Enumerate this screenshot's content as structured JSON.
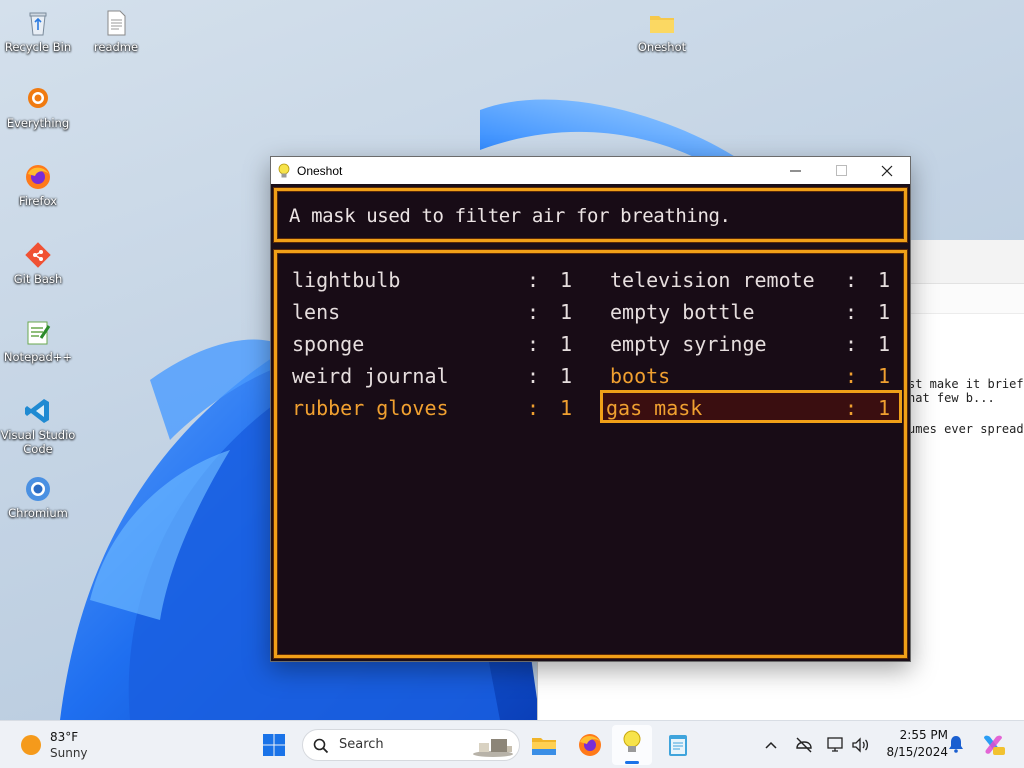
{
  "desktop": {
    "icons": [
      {
        "label": "Recycle Bin",
        "icon": "recycle-bin-icon"
      },
      {
        "label": "readme",
        "icon": "text-file-icon"
      },
      {
        "label": "Oneshot",
        "icon": "folder-icon"
      },
      {
        "label": "Everything",
        "icon": "everything-icon"
      },
      {
        "label": "Firefox",
        "icon": "firefox-icon"
      },
      {
        "label": "Git Bash",
        "icon": "git-bash-icon"
      },
      {
        "label": "Notepad++",
        "icon": "notepad-plus-plus-icon"
      },
      {
        "label": "Visual Studio Code",
        "icon": "vscode-icon"
      },
      {
        "label": "Chromium",
        "icon": "chromium-icon"
      }
    ]
  },
  "background_window": {
    "lines": [
      "st make it brief",
      "hat few b...",
      "umes ever spread"
    ]
  },
  "oneshot_window": {
    "title": "Oneshot",
    "description": "A mask used to filter air for breathing.",
    "items": [
      {
        "name": "lightbulb",
        "sep": ":",
        "qty": "1"
      },
      {
        "name": "television remote",
        "sep": ":",
        "qty": "1"
      },
      {
        "name": "lens",
        "sep": ":",
        "qty": "1"
      },
      {
        "name": "empty bottle",
        "sep": ":",
        "qty": "1"
      },
      {
        "name": "sponge",
        "sep": ":",
        "qty": "1"
      },
      {
        "name": "empty syringe",
        "sep": ":",
        "qty": "1"
      },
      {
        "name": "weird journal",
        "sep": ":",
        "qty": "1"
      },
      {
        "name": "boots",
        "sep": ":",
        "qty": "1"
      },
      {
        "name": "rubber gloves",
        "sep": ":",
        "qty": "1"
      },
      {
        "name": "gas mask",
        "sep": ":",
        "qty": "1"
      }
    ],
    "highlight_color": "#f0a030",
    "selected_item": "gas mask"
  },
  "taskbar": {
    "weather_temp": "83°F",
    "weather_desc": "Sunny",
    "search_placeholder": "Search",
    "time": "2:55 PM",
    "date": "8/15/2024"
  }
}
